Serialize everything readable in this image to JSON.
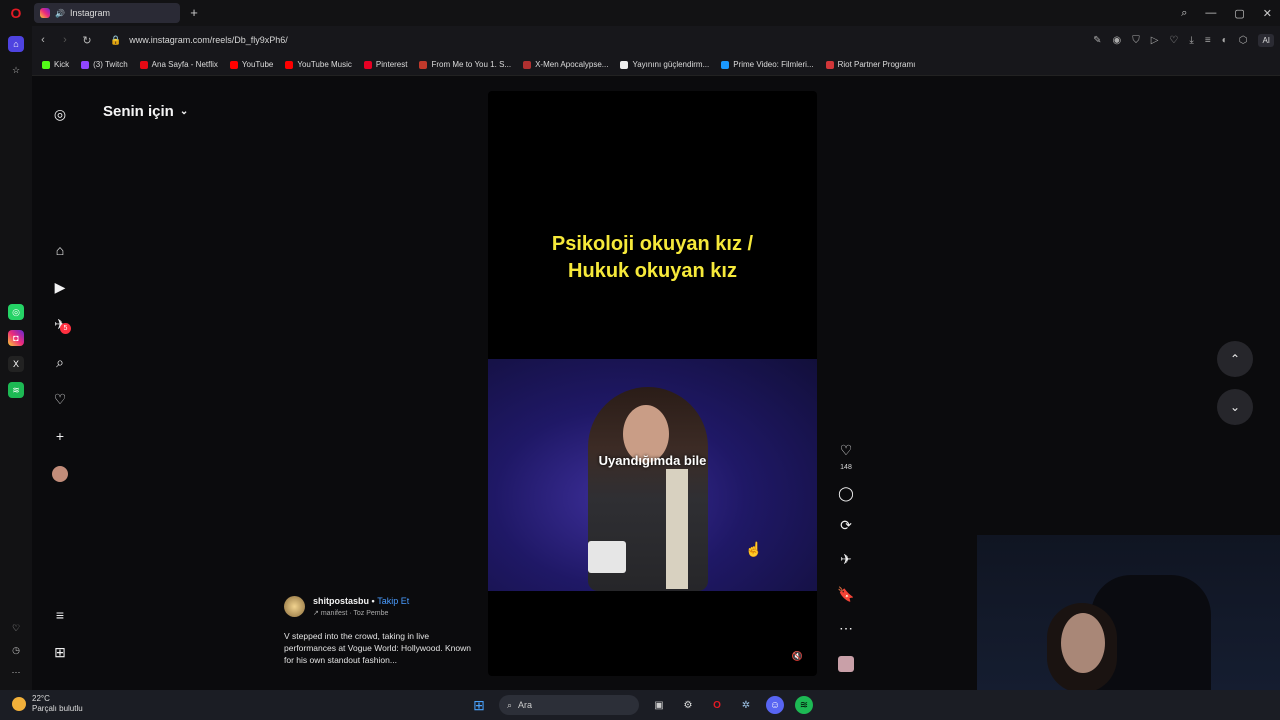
{
  "browser": {
    "tab_title": "Instagram",
    "url": "www.instagram.com/reels/Db_fly9xPh6/",
    "ai_label": "AI",
    "bookmarks": [
      {
        "label": "Kick",
        "color": "#53fc18"
      },
      {
        "label": "(3) Twitch",
        "color": "#9146ff"
      },
      {
        "label": "Ana Sayfa - Netflix",
        "color": "#e50914"
      },
      {
        "label": "YouTube",
        "color": "#ff0000"
      },
      {
        "label": "YouTube Music",
        "color": "#ff0000"
      },
      {
        "label": "Pinterest",
        "color": "#e60023"
      },
      {
        "label": "From Me to You 1. S...",
        "color": "#c0392b"
      },
      {
        "label": "X-Men Apocalypse...",
        "color": "#b03030"
      },
      {
        "label": "Yayınını güçlendirm...",
        "color": "#eeeeee"
      },
      {
        "label": "Prime Video: Filmleri...",
        "color": "#1a98ff"
      },
      {
        "label": "Riot Partner Programı",
        "color": "#d13639"
      }
    ]
  },
  "instagram": {
    "feed_title": "Senin için",
    "nav_badge": "5",
    "video": {
      "caption_line1": "Psikoloji okuyan kız /",
      "caption_line2": "Hukuk okuyan kız",
      "subtitle": "Uyandığımda bile"
    },
    "like_count": "148",
    "author": {
      "username": "shitpostasbu",
      "follow_label": "Takip Et",
      "music": "manifest · Toz Pembe",
      "description": "V stepped into the crowd, taking in live performances at Vogue World: Hollywood. Known for his own standout fashion..."
    }
  },
  "taskbar": {
    "temperature": "22°C",
    "weather_text": "Parçalı bulutlu",
    "search_placeholder": "Ara"
  },
  "colors": {
    "accent_blue": "#4a9cff",
    "caption_yellow": "#f6e93a",
    "badge_red": "#ff3040"
  }
}
